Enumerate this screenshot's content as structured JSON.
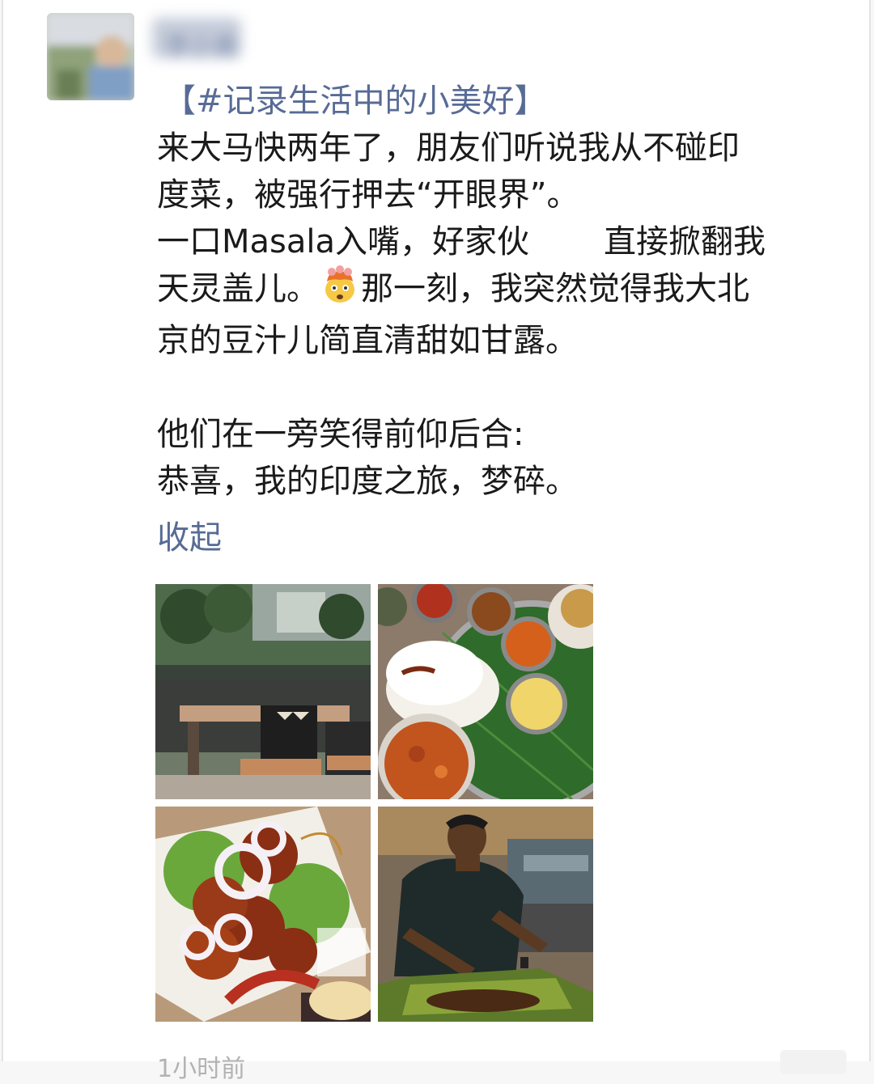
{
  "post": {
    "hashtag": "【#记录生活中的小美好】",
    "paragraph1": {
      "line1": "来大马快两年了，朋友们听说我从不碰印",
      "line2": "度菜，被强行押去“开眼界”。",
      "line3a": "一口Masala入嘴，好家伙",
      "line3b": "直接掀翻我",
      "line4a": "天灵盖儿。",
      "line4b": "那一刻，我突然觉得我大北",
      "line5": "京的豆汁儿简直清甜如甘露。"
    },
    "paragraph2": {
      "line1": "他们在一旁笑得前仰后合:",
      "line2": "恭喜，我的印度之旅，梦碎。"
    },
    "collapse_label": "收起",
    "emoji_icon": "exploding-head-emoji",
    "timestamp": "1小时前"
  },
  "user": {
    "name": "李小美"
  },
  "photos": [
    {
      "subject": "restaurant interior with tables and chairs"
    },
    {
      "subject": "banana leaf thali with rice and curries"
    },
    {
      "subject": "fried chicken with onion rings and lettuce"
    },
    {
      "subject": "waiter serving on banana leaf"
    }
  ],
  "colors": {
    "link": "#576b95",
    "text": "#1a1a1a",
    "background": "#ffffff"
  }
}
